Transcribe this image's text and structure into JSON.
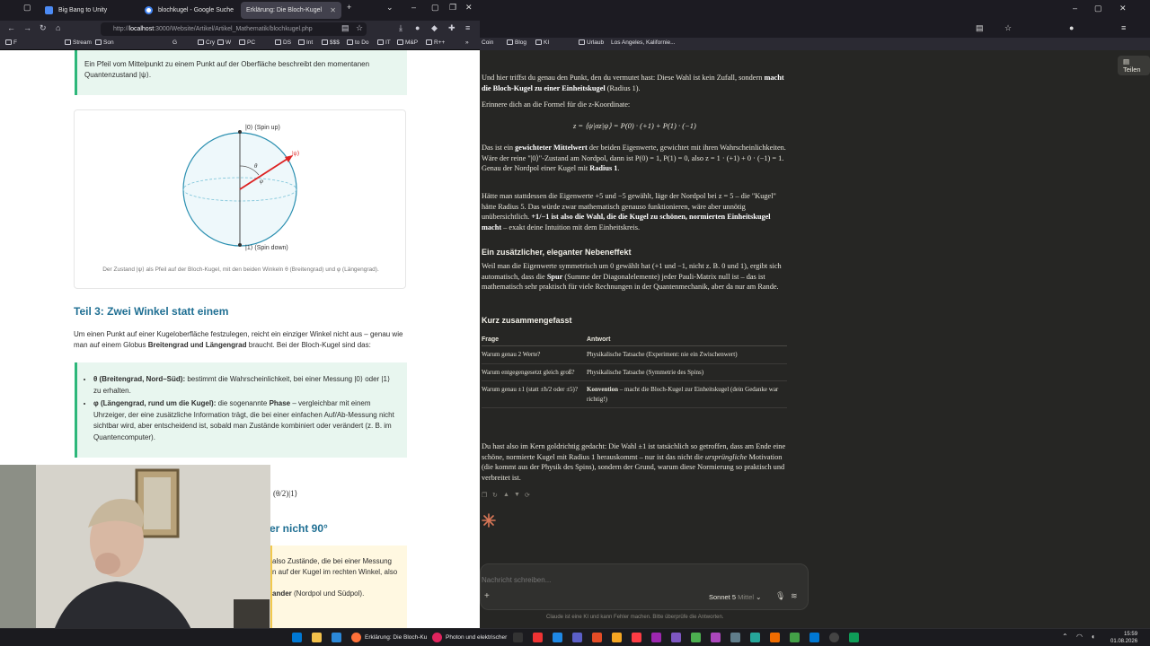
{
  "left_browser": {
    "tabs": [
      {
        "title": "Big Bang to Unity",
        "active": false
      },
      {
        "title": "blochkugel - Google Suche",
        "active": false
      },
      {
        "title": "Erklärung: Die Bloch-Kugel",
        "active": true
      }
    ],
    "url_prefix": "http://",
    "url_host": "localhost",
    "url_rest": ":3000/Website/Artikel/Artikel_Mathematik/blochkugel.php",
    "bookmarks": [
      "F",
      "Stream",
      "Son",
      "G",
      "Cry",
      "W",
      "PC",
      "DS",
      "Int",
      "$$$",
      "to Do",
      "IT",
      "M&P",
      "R++"
    ],
    "callout_top": "Ein Pfeil vom Mittelpunkt zu einem Punkt auf der Oberfläche beschreibt den momentanen Quantenzustand |ψ⟩.",
    "figure": {
      "label_up": "|0⟩ (Spin up)",
      "label_down": "|1⟩ (Spin down)",
      "label_psi": "|ψ⟩",
      "label_theta": "θ",
      "label_phi": "φ",
      "caption": "Der Zustand |ψ⟩ als Pfeil auf der Bloch-Kugel, mit den beiden Winkeln θ (Breitengrad) und φ (Längengrad)."
    },
    "section3_title": "Teil 3: Zwei Winkel statt einem",
    "section3_intro_1": "Um einen Punkt auf einer Kugeloberfläche festzulegen, reicht ein einziger Winkel nicht aus – genau wie",
    "section3_intro_2a": "man auf einem Globus ",
    "section3_intro_2b": "Breitengrad und Längengrad",
    "section3_intro_2c": " braucht. Bei der Bloch-Kugel sind das:",
    "bullet1_term": "θ (Breitengrad, Nord–Süd):",
    "bullet1_text": " bestimmt die Wahrscheinlichkeit, bei einer Messung |0⟩ oder |1⟩ zu erhalten.",
    "bullet2_term": "φ (Längengrad, rund um die Kugel):",
    "bullet2_text_a": " die sogenannte ",
    "bullet2_phase": "Phase",
    "bullet2_text_b": " – vergleichbar mit einem Uhrzeiger, der eine zusätzliche Information trägt, die bei einer einfachen Auf/Ab-Messung nicht sichtbar wird, aber entscheidend ist, sobald man Zustände kombiniert oder verändert (z. B. im Quantencomputer).",
    "formula_fragment": "(θ/2)|1⟩",
    "heading_fragment": "er nicht 90°",
    "yellow_line1": "also Zustände, die bei einer Messung",
    "yellow_line2": "n auf der Kugel im rechten Winkel, also",
    "yellow_line3_bold": "ander",
    "yellow_line3_rest": " (Nordpol und Südpol)."
  },
  "right_browser": {
    "bookmarks": [
      "Coin",
      "Blog",
      "KI",
      "Urlaub",
      "Los Angeles, Kalifornie..."
    ],
    "share_label": "Teilen",
    "p1_a": "Und hier triffst du genau den Punkt, den du vermutet hast: Diese Wahl ist kein Zufall, sondern ",
    "p1_b": "macht die Bloch-Kugel zu einer Einheitskugel",
    "p1_c": " (Radius 1).",
    "p2": "Erinnere dich an die Formel für die z-Koordinate:",
    "formula_z": "z = ⟨ψ|σz|ψ⟩ = P(0) · (+1) + P(1) · (−1)",
    "p3_a": "Das ist ein ",
    "p3_b": "gewichteter Mittelwert",
    "p3_c": " der beiden Eigenwerte, gewichtet mit ihren Wahrscheinlichkeiten. Wäre der reine \"|0⟩\"-Zustand am Nordpol, dann ist P(0) = 1, P(1) = 0, also z = 1 · (+1) + 0 · (−1) = 1. Genau der Nordpol einer Kugel mit ",
    "p3_d": "Radius 1",
    "p3_e": ".",
    "p4_a": "Hätte man stattdessen die Eigenwerte +5 und −5 gewählt, läge der Nordpol bei z = 5 – die \"Kugel\" hätte Radius 5. Das würde zwar mathematisch genauso funktionieren, wäre aber unnötig unübersichtlich. ",
    "p4_b": "+1/−1 ist also die Wahl, die die Kugel zu schönen, normierten Einheitskugel macht",
    "p4_c": " – exakt deine Intuition mit dem Einheitskreis.",
    "h_extra": "Ein zusätzlicher, eleganter Nebeneffekt",
    "p5_a": "Weil man die Eigenwerte symmetrisch um 0 gewählt hat (+1 und −1, nicht z. B. 0 und 1), ergibt sich automatisch, dass die ",
    "p5_b": "Spur",
    "p5_c": " (Summe der Diagonalelemente) jeder Pauli-Matrix null ist – das ist mathematisch sehr praktisch für viele Rechnungen in der Quantenmechanik, aber da nur am Rande.",
    "h_summary": "Kurz zusammengefasst",
    "table": {
      "headers": [
        "Frage",
        "Antwort"
      ],
      "rows": [
        {
          "q": "Warum genau 2 Werte?",
          "a_bold": "",
          "a": "Physikalische Tatsache (Experiment: nie ein Zwischenwert)"
        },
        {
          "q": "Warum entgegengesetzt gleich groß?",
          "a_bold": "",
          "a": "Physikalische Tatsache (Symmetrie des Spins)"
        },
        {
          "q": "Warum genau ±1 (statt ±ħ/2 oder ±5)?",
          "a_bold": "Konvention",
          "a": " – macht die Bloch-Kugel zur Einheitskugel (dein Gedanke war richtig!)"
        }
      ]
    },
    "p6_a": "Du hast also im Kern goldrichtig gedacht: Die Wahl ±1 ist tatsächlich so getroffen, dass am Ende eine schöne, normierte Kugel mit Radius 1 herauskommt – nur ist das nicht die ",
    "p6_b": "ursprüngliche",
    "p6_c": " Motivation (die kommt aus der Physik des Spins), sondern der Grund, warum diese Normierung so praktisch und verbreitet ist.",
    "composer_placeholder": "Nachricht schreiben...",
    "model_label": "Sonnet 5",
    "effort_label": "Mittel",
    "disclaimer": "Claude ist eine KI und kann Fehler machen. Bitte überprüfe die Antworten."
  },
  "taskbar": {
    "items": [
      {
        "label": "Erklärung: Die Bloch-Ku",
        "color": "#ff7139"
      },
      {
        "label": "Photon und elektrischer",
        "color": "#e0245e"
      }
    ],
    "time": "15:59",
    "date": "01.08.2026"
  },
  "colors": {
    "accent_teal": "#1f6f93",
    "callout_green": "#2db77a",
    "callout_yellow": "#f2c94c",
    "claude_star": "#d97757"
  }
}
